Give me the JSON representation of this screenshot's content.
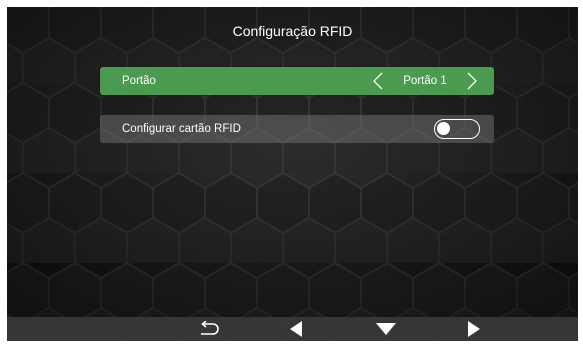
{
  "header": {
    "title": "Configuração RFID"
  },
  "gate_row": {
    "label": "Portão",
    "value": "Portão 1",
    "prev_icon": "chevron-left-icon",
    "next_icon": "chevron-right-icon"
  },
  "rfid_row": {
    "label": "Configurar cartão RFID",
    "toggle_state": "off"
  },
  "bottom_nav": {
    "back_icon": "return-icon",
    "left_icon": "triangle-left-icon",
    "down_icon": "triangle-down-icon",
    "right_icon": "triangle-right-icon"
  },
  "colors": {
    "selected_row": "#4a9a4f",
    "row": "#5a5a5a",
    "text": "#ffffff",
    "background": "#222222"
  }
}
